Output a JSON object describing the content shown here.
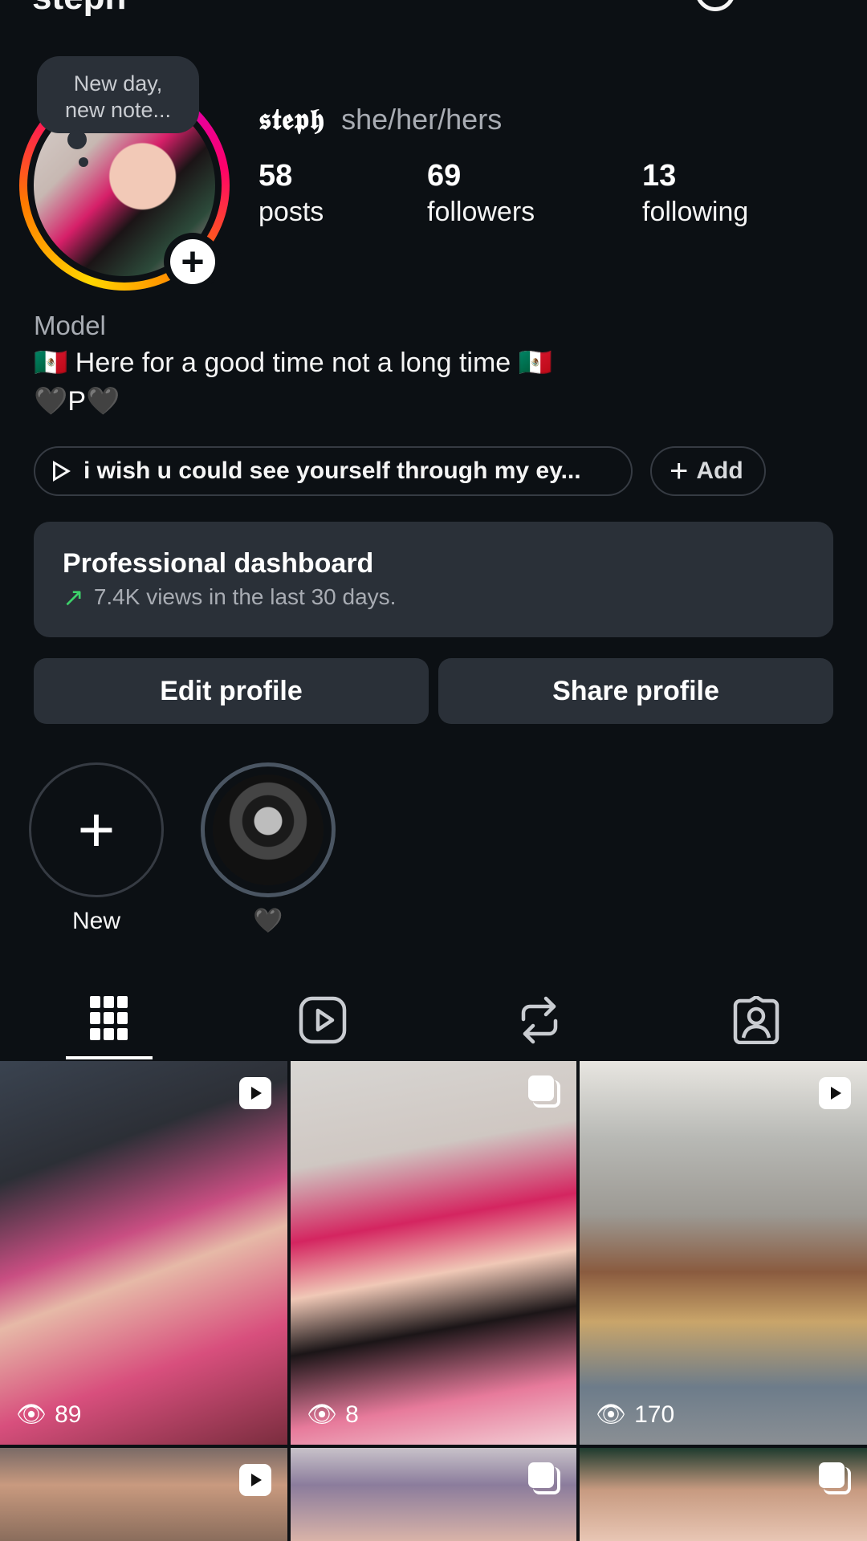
{
  "header": {
    "title": "steph"
  },
  "note": {
    "line1": "New day,",
    "line2": "new note..."
  },
  "profile": {
    "name": "𝖘𝖙𝖊𝖕𝖍",
    "pronouns": "she/her/hers",
    "stats": [
      {
        "value": "58",
        "label": "posts"
      },
      {
        "value": "69",
        "label": "followers"
      },
      {
        "value": "13",
        "label": "following"
      }
    ],
    "category": "Model",
    "bio_line1": "🇲🇽 Here for a good time not a long time 🇲🇽",
    "bio_line2": "🖤P🖤"
  },
  "chips": {
    "music": "i wish u could see yourself through my ey...",
    "add": "Add"
  },
  "dashboard": {
    "title": "Professional dashboard",
    "subtitle": "7.4K views in the last 30 days."
  },
  "buttons": {
    "edit": "Edit profile",
    "share": "Share profile"
  },
  "highlights": [
    {
      "label": "New"
    },
    {
      "label": "🖤"
    }
  ],
  "tabs": [
    {
      "icon": "grid-icon"
    },
    {
      "icon": "reels-icon"
    },
    {
      "icon": "reposts-icon"
    },
    {
      "icon": "tagged-icon"
    }
  ],
  "posts": [
    {
      "type": "reel",
      "views": "89"
    },
    {
      "type": "carousel",
      "views": "8"
    },
    {
      "type": "reel",
      "views": "170"
    },
    {
      "type": "reel",
      "views": ""
    },
    {
      "type": "carousel",
      "views": ""
    },
    {
      "type": "carousel",
      "views": ""
    }
  ],
  "colors": {
    "background": "#0c1014",
    "card": "#2a3038",
    "secondary_text": "#a8acb3",
    "trend_green": "#3dd16a"
  }
}
